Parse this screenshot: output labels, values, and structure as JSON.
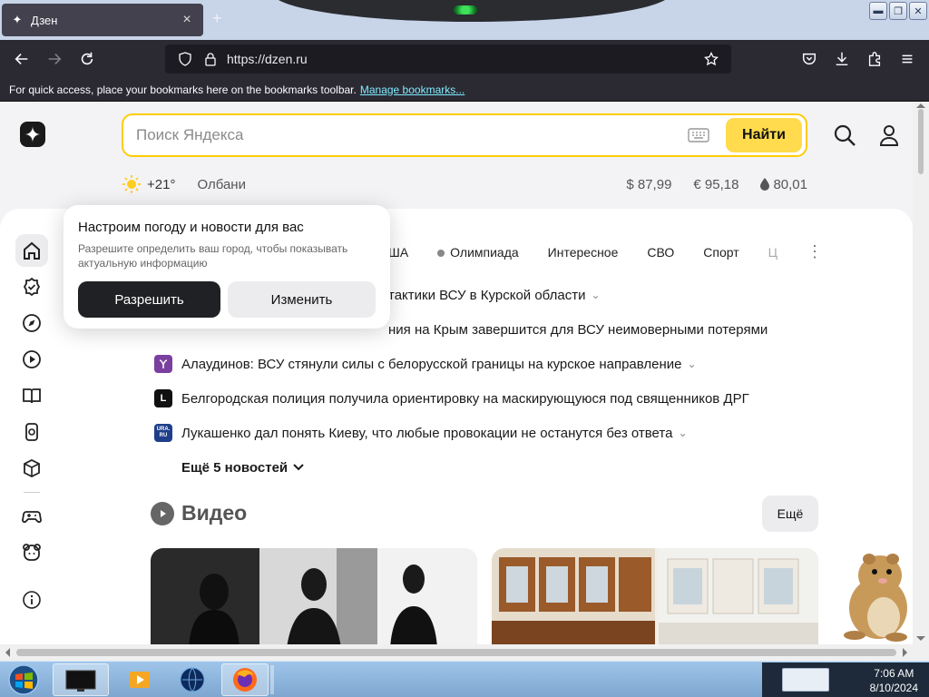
{
  "browser": {
    "tab": {
      "title": "Дзен",
      "close": "×"
    },
    "new_tab": "+",
    "url": "https://dzen.ru",
    "bookmarks_text": "For quick access, place your bookmarks here on the bookmarks toolbar.",
    "bookmarks_link": "Manage bookmarks..."
  },
  "header": {
    "search_placeholder": "Поиск Яндекса",
    "search_button": "Найти"
  },
  "info": {
    "temperature": "+21°",
    "city": "Олбани",
    "usd": "$ 87,99",
    "eur": "€ 95,18",
    "oil": "80,01"
  },
  "popup": {
    "title": "Настроим погоду и новости для вас",
    "text": "Разрешите определить ваш город, чтобы показывать актуальную информацию",
    "allow": "Разрешить",
    "change": "Изменить"
  },
  "news_tabs": [
    {
      "label": "ША"
    },
    {
      "label": "Олимпиада"
    },
    {
      "label": "Интересное"
    },
    {
      "label": "СВО"
    },
    {
      "label": "Спорт"
    },
    {
      "label": "Ц"
    }
  ],
  "news": [
    {
      "text": "тактики ВСУ в Курской области",
      "source_color": "#ffffff"
    },
    {
      "text": "ния на Крым завершится для ВСУ неимоверными потерями",
      "source_color": "#ffffff"
    },
    {
      "text": "Алаудинов: ВСУ стянули силы с белорусской границы на курское направление",
      "source_color": "#7b3fa0"
    },
    {
      "text": "Белгородская полиция получила ориентировку на маскирующуюся под священников ДРГ",
      "source_color": "#111111"
    },
    {
      "text": "Лукашенко дал понять Киеву, что любые провокации не останутся без ответа",
      "source_color": "#1f3f8a"
    }
  ],
  "news_sources": {
    "logo_l": "L",
    "logo_ura_top": "URA.",
    "logo_ura_bottom": "RU"
  },
  "more_news": "Ещё 5 новостей",
  "video": {
    "title": "Видео",
    "more": "Ещё"
  },
  "taskbar": {
    "time": "7:06 AM",
    "date": "8/10/2024"
  },
  "colors": {
    "accent": "#ffdb4d",
    "search_border": "#ffcc00",
    "browser_chrome": "#2b2a33"
  }
}
